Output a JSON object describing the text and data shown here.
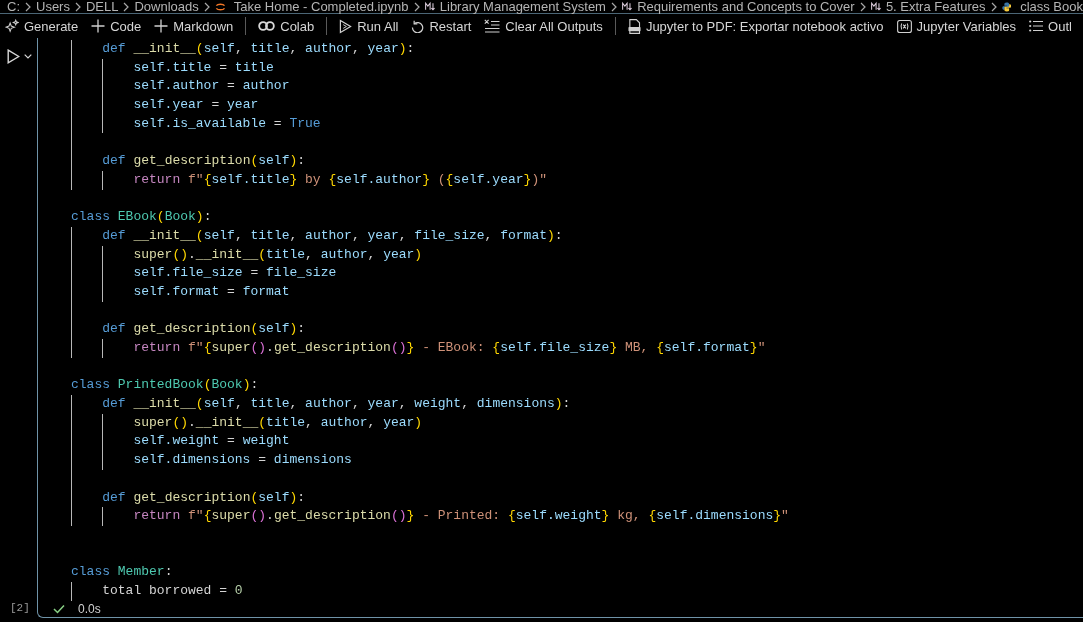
{
  "breadcrumbs": [
    {
      "kind": "path",
      "label": "C:"
    },
    {
      "kind": "path",
      "label": "Users"
    },
    {
      "kind": "path",
      "label": "DELL"
    },
    {
      "kind": "path",
      "label": "Downloads"
    },
    {
      "kind": "notebook",
      "label": "Take Home - Completed.ipynb"
    },
    {
      "kind": "markdown",
      "label": "Library Management System"
    },
    {
      "kind": "markdown",
      "label": "Requirements and Concepts to Cover"
    },
    {
      "kind": "markdown",
      "label": "5. Extra Features"
    },
    {
      "kind": "python",
      "label": "class Book"
    }
  ],
  "toolbar": [
    {
      "kind": "generate",
      "label": "Generate"
    },
    {
      "kind": "add",
      "label": "Code"
    },
    {
      "kind": "add",
      "label": "Markdown"
    },
    {
      "kind": "separator"
    },
    {
      "kind": "colab",
      "label": "Colab"
    },
    {
      "kind": "separator"
    },
    {
      "kind": "run",
      "label": "Run All"
    },
    {
      "kind": "restart",
      "label": "Restart"
    },
    {
      "kind": "clear",
      "label": "Clear All Outputs"
    },
    {
      "kind": "separator"
    },
    {
      "kind": "export",
      "label": "Jupyter to PDF: Exportar notebook activo"
    },
    {
      "kind": "variables",
      "label": "Jupyter Variables"
    },
    {
      "kind": "outline",
      "label": "Outl"
    }
  ],
  "cell": {
    "selected": true,
    "execution_count": "[2]",
    "succeeded": true,
    "duration": "0.0s",
    "lines": [
      {
        "kind": "code",
        "tokens": [
          {
            "kind": "keyword",
            "text": "    def "
          },
          {
            "kind": "function",
            "text": "__init__"
          },
          {
            "kind": "bracket",
            "text": "("
          },
          {
            "kind": "variable",
            "text": "self"
          },
          {
            "kind": "plain",
            "text": ", "
          },
          {
            "kind": "variable",
            "text": "title"
          },
          {
            "kind": "plain",
            "text": ", "
          },
          {
            "kind": "variable",
            "text": "author"
          },
          {
            "kind": "plain",
            "text": ", "
          },
          {
            "kind": "variable",
            "text": "year"
          },
          {
            "kind": "bracket",
            "text": ")"
          },
          {
            "kind": "plain",
            "text": ":"
          }
        ]
      },
      {
        "kind": "code",
        "tokens": [
          {
            "kind": "variable",
            "text": "        self.title"
          },
          {
            "kind": "plain",
            "text": " = "
          },
          {
            "kind": "variable",
            "text": "title"
          }
        ]
      },
      {
        "kind": "code",
        "tokens": [
          {
            "kind": "variable",
            "text": "        self.author"
          },
          {
            "kind": "plain",
            "text": " = "
          },
          {
            "kind": "variable",
            "text": "author"
          }
        ]
      },
      {
        "kind": "code",
        "tokens": [
          {
            "kind": "variable",
            "text": "        self.year"
          },
          {
            "kind": "plain",
            "text": " = "
          },
          {
            "kind": "variable",
            "text": "year"
          }
        ]
      },
      {
        "kind": "code",
        "tokens": [
          {
            "kind": "variable",
            "text": "        self.is_available"
          },
          {
            "kind": "plain",
            "text": " = "
          },
          {
            "kind": "keyword",
            "text": "True"
          }
        ]
      },
      {
        "kind": "blank"
      },
      {
        "kind": "code",
        "tokens": [
          {
            "kind": "keyword",
            "text": "    def "
          },
          {
            "kind": "function",
            "text": "get_description"
          },
          {
            "kind": "bracket",
            "text": "("
          },
          {
            "kind": "variable",
            "text": "self"
          },
          {
            "kind": "bracket",
            "text": ")"
          },
          {
            "kind": "plain",
            "text": ":"
          }
        ]
      },
      {
        "kind": "code",
        "tokens": [
          {
            "kind": "control",
            "text": "        return "
          },
          {
            "kind": "string",
            "text": "f\""
          },
          {
            "kind": "bracket",
            "text": "{"
          },
          {
            "kind": "variable",
            "text": "self.title"
          },
          {
            "kind": "bracket",
            "text": "}"
          },
          {
            "kind": "string",
            "text": " by "
          },
          {
            "kind": "bracket",
            "text": "{"
          },
          {
            "kind": "variable",
            "text": "self.author"
          },
          {
            "kind": "bracket",
            "text": "}"
          },
          {
            "kind": "string",
            "text": " ("
          },
          {
            "kind": "bracket",
            "text": "{"
          },
          {
            "kind": "variable",
            "text": "self.year"
          },
          {
            "kind": "bracket",
            "text": "}"
          },
          {
            "kind": "string",
            "text": ")\""
          }
        ]
      },
      {
        "kind": "blank"
      },
      {
        "kind": "code",
        "tokens": [
          {
            "kind": "keyword",
            "text": "class "
          },
          {
            "kind": "type",
            "text": "EBook"
          },
          {
            "kind": "bracket",
            "text": "("
          },
          {
            "kind": "type",
            "text": "Book"
          },
          {
            "kind": "bracket",
            "text": ")"
          },
          {
            "kind": "plain",
            "text": ":"
          }
        ]
      },
      {
        "kind": "code",
        "tokens": [
          {
            "kind": "keyword",
            "text": "    def "
          },
          {
            "kind": "function",
            "text": "__init__"
          },
          {
            "kind": "bracket",
            "text": "("
          },
          {
            "kind": "variable",
            "text": "self"
          },
          {
            "kind": "plain",
            "text": ", "
          },
          {
            "kind": "variable",
            "text": "title"
          },
          {
            "kind": "plain",
            "text": ", "
          },
          {
            "kind": "variable",
            "text": "author"
          },
          {
            "kind": "plain",
            "text": ", "
          },
          {
            "kind": "variable",
            "text": "year"
          },
          {
            "kind": "plain",
            "text": ", "
          },
          {
            "kind": "variable",
            "text": "file_size"
          },
          {
            "kind": "plain",
            "text": ", "
          },
          {
            "kind": "variable",
            "text": "format"
          },
          {
            "kind": "bracket",
            "text": ")"
          },
          {
            "kind": "plain",
            "text": ":"
          }
        ]
      },
      {
        "kind": "code",
        "tokens": [
          {
            "kind": "function",
            "text": "        super"
          },
          {
            "kind": "bracket",
            "text": "()"
          },
          {
            "kind": "plain",
            "text": "."
          },
          {
            "kind": "function",
            "text": "__init__"
          },
          {
            "kind": "bracket",
            "text": "("
          },
          {
            "kind": "variable",
            "text": "title"
          },
          {
            "kind": "plain",
            "text": ", "
          },
          {
            "kind": "variable",
            "text": "author"
          },
          {
            "kind": "plain",
            "text": ", "
          },
          {
            "kind": "variable",
            "text": "year"
          },
          {
            "kind": "bracket",
            "text": ")"
          }
        ]
      },
      {
        "kind": "code",
        "tokens": [
          {
            "kind": "variable",
            "text": "        self.file_size"
          },
          {
            "kind": "plain",
            "text": " = "
          },
          {
            "kind": "variable",
            "text": "file_size"
          }
        ]
      },
      {
        "kind": "code",
        "tokens": [
          {
            "kind": "variable",
            "text": "        self.format"
          },
          {
            "kind": "plain",
            "text": " = "
          },
          {
            "kind": "variable",
            "text": "format"
          }
        ]
      },
      {
        "kind": "blank"
      },
      {
        "kind": "code",
        "tokens": [
          {
            "kind": "keyword",
            "text": "    def "
          },
          {
            "kind": "function",
            "text": "get_description"
          },
          {
            "kind": "bracket",
            "text": "("
          },
          {
            "kind": "variable",
            "text": "self"
          },
          {
            "kind": "bracket",
            "text": ")"
          },
          {
            "kind": "plain",
            "text": ":"
          }
        ]
      },
      {
        "kind": "code",
        "tokens": [
          {
            "kind": "control",
            "text": "        return "
          },
          {
            "kind": "string",
            "text": "f\""
          },
          {
            "kind": "bracket",
            "text": "{"
          },
          {
            "kind": "function",
            "text": "super"
          },
          {
            "kind": "nested",
            "text": "()"
          },
          {
            "kind": "plain",
            "text": "."
          },
          {
            "kind": "function",
            "text": "get_description"
          },
          {
            "kind": "nested",
            "text": "()"
          },
          {
            "kind": "bracket",
            "text": "}"
          },
          {
            "kind": "string",
            "text": " - EBook: "
          },
          {
            "kind": "bracket",
            "text": "{"
          },
          {
            "kind": "variable",
            "text": "self.file_size"
          },
          {
            "kind": "bracket",
            "text": "}"
          },
          {
            "kind": "string",
            "text": " MB, "
          },
          {
            "kind": "bracket",
            "text": "{"
          },
          {
            "kind": "variable",
            "text": "self.format"
          },
          {
            "kind": "bracket",
            "text": "}"
          },
          {
            "kind": "string",
            "text": "\""
          }
        ]
      },
      {
        "kind": "blank"
      },
      {
        "kind": "code",
        "tokens": [
          {
            "kind": "keyword",
            "text": "class "
          },
          {
            "kind": "type",
            "text": "PrintedBook"
          },
          {
            "kind": "bracket",
            "text": "("
          },
          {
            "kind": "type",
            "text": "Book"
          },
          {
            "kind": "bracket",
            "text": ")"
          },
          {
            "kind": "plain",
            "text": ":"
          }
        ]
      },
      {
        "kind": "code",
        "tokens": [
          {
            "kind": "keyword",
            "text": "    def "
          },
          {
            "kind": "function",
            "text": "__init__"
          },
          {
            "kind": "bracket",
            "text": "("
          },
          {
            "kind": "variable",
            "text": "self"
          },
          {
            "kind": "plain",
            "text": ", "
          },
          {
            "kind": "variable",
            "text": "title"
          },
          {
            "kind": "plain",
            "text": ", "
          },
          {
            "kind": "variable",
            "text": "author"
          },
          {
            "kind": "plain",
            "text": ", "
          },
          {
            "kind": "variable",
            "text": "year"
          },
          {
            "kind": "plain",
            "text": ", "
          },
          {
            "kind": "variable",
            "text": "weight"
          },
          {
            "kind": "plain",
            "text": ", "
          },
          {
            "kind": "variable",
            "text": "dimensions"
          },
          {
            "kind": "bracket",
            "text": ")"
          },
          {
            "kind": "plain",
            "text": ":"
          }
        ]
      },
      {
        "kind": "code",
        "tokens": [
          {
            "kind": "function",
            "text": "        super"
          },
          {
            "kind": "bracket",
            "text": "()"
          },
          {
            "kind": "plain",
            "text": "."
          },
          {
            "kind": "function",
            "text": "__init__"
          },
          {
            "kind": "bracket",
            "text": "("
          },
          {
            "kind": "variable",
            "text": "title"
          },
          {
            "kind": "plain",
            "text": ", "
          },
          {
            "kind": "variable",
            "text": "author"
          },
          {
            "kind": "plain",
            "text": ", "
          },
          {
            "kind": "variable",
            "text": "year"
          },
          {
            "kind": "bracket",
            "text": ")"
          }
        ]
      },
      {
        "kind": "code",
        "tokens": [
          {
            "kind": "variable",
            "text": "        self.weight"
          },
          {
            "kind": "plain",
            "text": " = "
          },
          {
            "kind": "variable",
            "text": "weight"
          }
        ]
      },
      {
        "kind": "code",
        "tokens": [
          {
            "kind": "variable",
            "text": "        self.dimensions"
          },
          {
            "kind": "plain",
            "text": " = "
          },
          {
            "kind": "variable",
            "text": "dimensions"
          }
        ]
      },
      {
        "kind": "blank"
      },
      {
        "kind": "code",
        "tokens": [
          {
            "kind": "keyword",
            "text": "    def "
          },
          {
            "kind": "function",
            "text": "get_description"
          },
          {
            "kind": "bracket",
            "text": "("
          },
          {
            "kind": "variable",
            "text": "self"
          },
          {
            "kind": "bracket",
            "text": ")"
          },
          {
            "kind": "plain",
            "text": ":"
          }
        ]
      },
      {
        "kind": "code",
        "tokens": [
          {
            "kind": "control",
            "text": "        return "
          },
          {
            "kind": "string",
            "text": "f\""
          },
          {
            "kind": "bracket",
            "text": "{"
          },
          {
            "kind": "function",
            "text": "super"
          },
          {
            "kind": "nested",
            "text": "()"
          },
          {
            "kind": "plain",
            "text": "."
          },
          {
            "kind": "function",
            "text": "get_description"
          },
          {
            "kind": "nested",
            "text": "()"
          },
          {
            "kind": "bracket",
            "text": "}"
          },
          {
            "kind": "string",
            "text": " - Printed: "
          },
          {
            "kind": "bracket",
            "text": "{"
          },
          {
            "kind": "variable",
            "text": "self.weight"
          },
          {
            "kind": "bracket",
            "text": "}"
          },
          {
            "kind": "string",
            "text": " kg, "
          },
          {
            "kind": "bracket",
            "text": "{"
          },
          {
            "kind": "variable",
            "text": "self.dimensions"
          },
          {
            "kind": "bracket",
            "text": "}"
          },
          {
            "kind": "string",
            "text": "\""
          }
        ]
      },
      {
        "kind": "blank"
      },
      {
        "kind": "blank"
      },
      {
        "kind": "code",
        "tokens": [
          {
            "kind": "keyword",
            "text": "class "
          },
          {
            "kind": "type",
            "text": "Member"
          },
          {
            "kind": "plain",
            "text": ":"
          }
        ]
      },
      {
        "kind": "code",
        "tokens": [
          {
            "kind": "plain",
            "text": "    total borrowed = "
          },
          {
            "kind": "number",
            "text": "0"
          }
        ]
      }
    ]
  }
}
